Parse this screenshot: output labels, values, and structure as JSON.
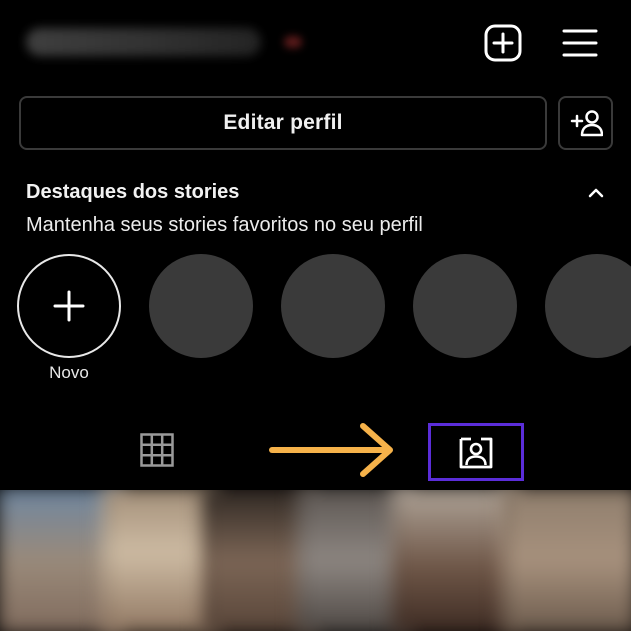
{
  "header": {
    "username": "",
    "icons": {
      "add_post": "plus-square-icon",
      "menu": "hamburger-menu-icon"
    }
  },
  "profile_actions": {
    "edit_profile_label": "Editar perfil",
    "discover_people_icon": "add-person-icon"
  },
  "highlights": {
    "title": "Destaques dos stories",
    "subtitle": "Mantenha seus stories favoritos no seu perfil",
    "collapse_icon": "chevron-up-icon",
    "new_label": "Novo",
    "placeholder_count": 4
  },
  "tabs": {
    "items": [
      {
        "icon": "grid-icon",
        "selected": false
      },
      {
        "icon": "tagged-person-icon",
        "selected": true
      }
    ]
  },
  "annotations": {
    "arrow_color": "#f6b24a",
    "highlight_box_color": "#5b2dd9"
  },
  "colors": {
    "background": "#000000",
    "border": "#3a3a3a",
    "placeholder": "#3a3a3a"
  }
}
